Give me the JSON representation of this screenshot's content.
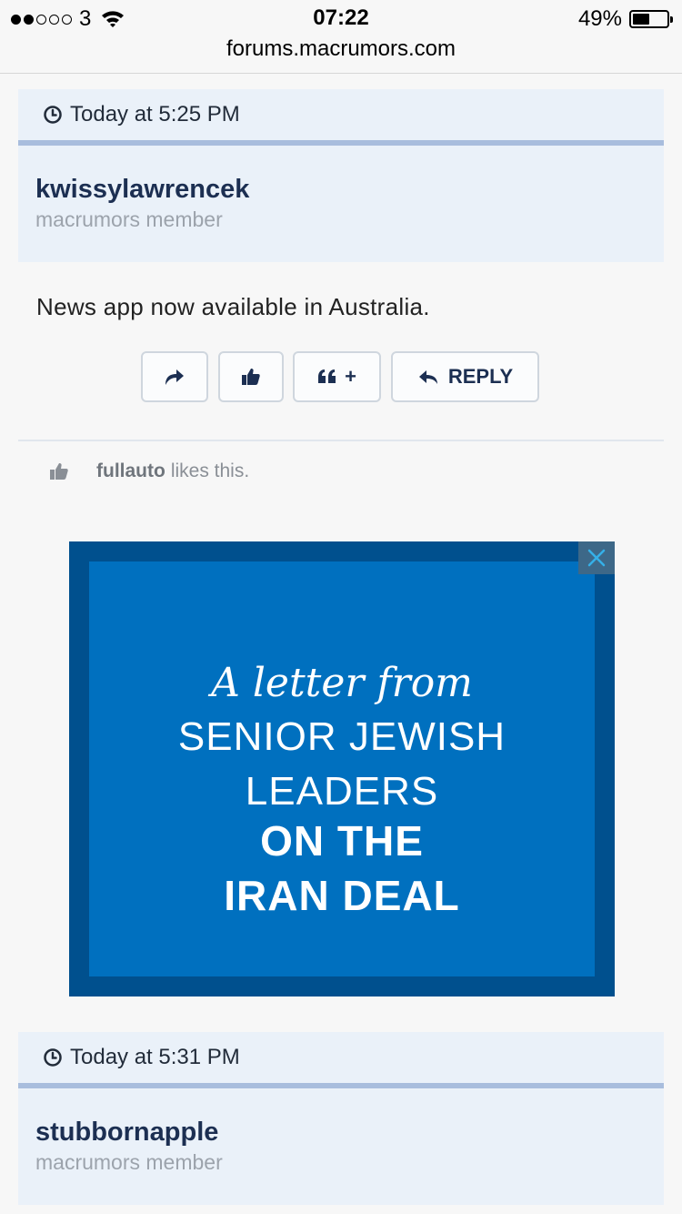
{
  "status_bar": {
    "carrier": "3",
    "time": "07:22",
    "battery_percent": "49%",
    "battery_level": 0.49,
    "signal_bars_filled": 2,
    "signal_bars_total": 5
  },
  "browser": {
    "url": "forums.macrumors.com"
  },
  "posts": [
    {
      "timestamp": "Today at 5:25 PM",
      "username": "kwissylawrencek",
      "user_title": "macrumors member",
      "message": "News app now available in Australia.",
      "actions": {
        "reply_label": "REPLY",
        "quote_plus": "+"
      },
      "likes": {
        "liker": "fullauto",
        "suffix": "likes this."
      }
    },
    {
      "timestamp": "Today at 5:31 PM",
      "username": "stubbornapple",
      "user_title": "macrumors member"
    }
  ],
  "ad": {
    "line1": "A letter from",
    "line2": "SENIOR JEWISH",
    "line3": "LEADERS",
    "line4": "ON THE",
    "line5": "IRAN DEAL",
    "colors": {
      "outer": "#00508e",
      "inner": "#0070bf"
    }
  },
  "colors": {
    "header_bg": "#eaf1f9",
    "header_border": "#a8bddd",
    "username": "#1c2f52",
    "user_title": "#9ca3ac"
  }
}
